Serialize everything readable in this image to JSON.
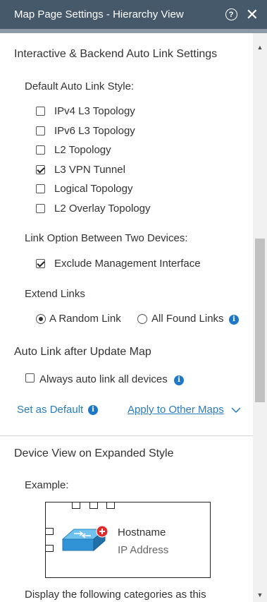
{
  "window": {
    "title": "Map Page Settings - Hierarchy View",
    "help_glyph": "?",
    "close_glyph": "✕"
  },
  "section1": {
    "title": "Interactive & Backend Auto Link Settings",
    "default_style_label": "Default Auto Link Style:",
    "styles": [
      {
        "label": "IPv4 L3 Topology",
        "checked": false
      },
      {
        "label": "IPv6 L3 Topology",
        "checked": false
      },
      {
        "label": "L2 Topology",
        "checked": false
      },
      {
        "label": "L3 VPN Tunnel",
        "checked": true
      },
      {
        "label": "Logical Topology",
        "checked": false
      },
      {
        "label": "L2 Overlay Topology",
        "checked": false
      }
    ],
    "link_option_label": "Link Option Between Two Devices:",
    "exclude_mgmt_label": "Exclude Management Interface",
    "exclude_mgmt_checked": true,
    "extend_links_label": "Extend Links",
    "extend_options": [
      {
        "label": "A Random Link",
        "selected": true
      },
      {
        "label": "All Found Links",
        "selected": false
      }
    ],
    "auto_link_title": "Auto Link after Update Map",
    "always_auto_link_label": "Always auto link all devices",
    "always_auto_link_checked": false,
    "set_default_label": "Set as Default",
    "apply_other_label": "Apply to Other Maps"
  },
  "section2": {
    "title": "Device View on Expanded Style",
    "example_label": "Example:",
    "hostname": "Hostname",
    "ip_address": "IP Address",
    "display_categories_label": "Display the following categories as this"
  },
  "colors": {
    "titlebar": "#45596b",
    "link": "#2a7bbf",
    "info_icon": "#1f77c9"
  }
}
